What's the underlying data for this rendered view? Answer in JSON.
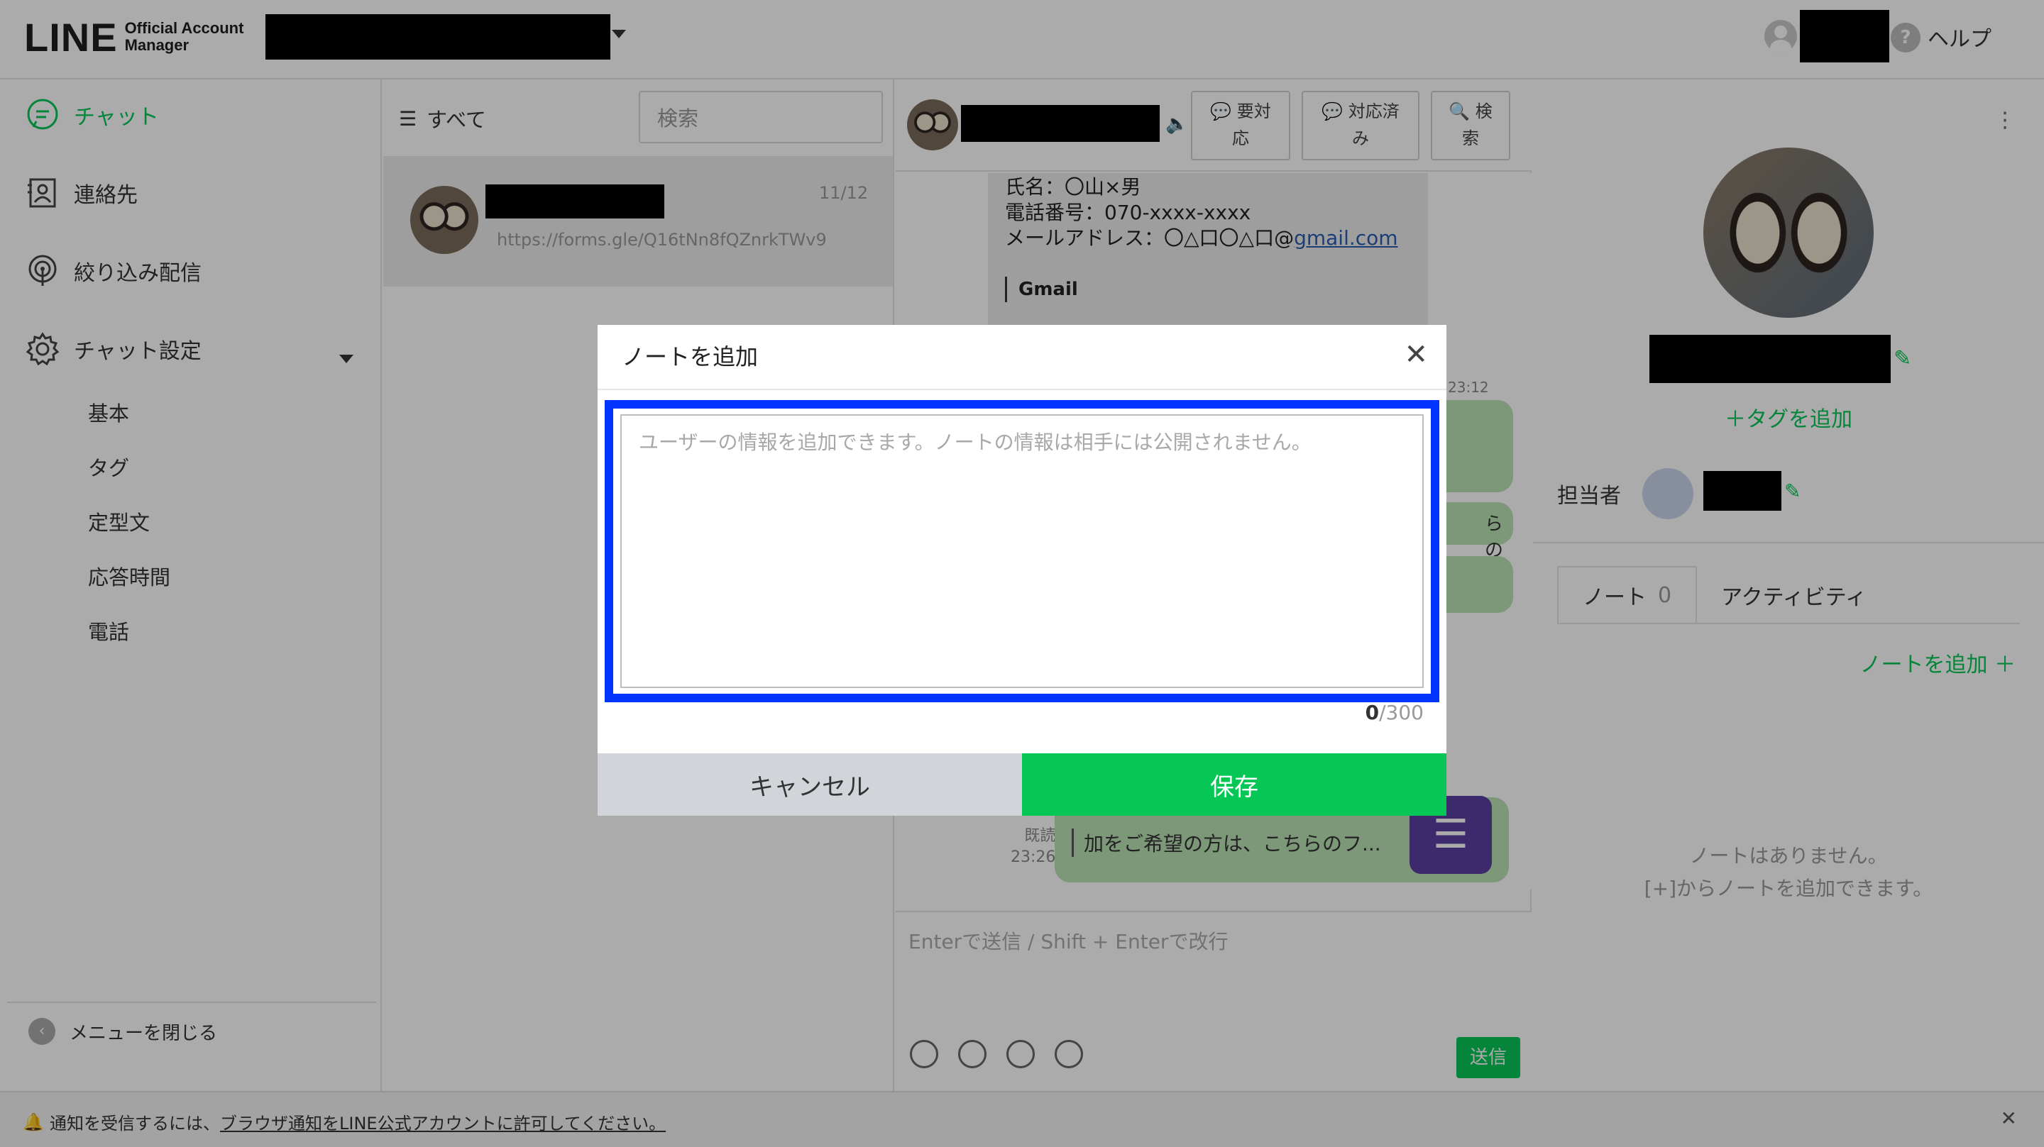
{
  "header": {
    "logo_main": "LINE",
    "logo_sub_1": "Official Account",
    "logo_sub_2": "Manager",
    "help_label": "ヘルプ",
    "help_glyph": "?"
  },
  "sidebar": {
    "items": [
      {
        "label": "チャット",
        "icon": "chat-bubble-icon"
      },
      {
        "label": "連絡先",
        "icon": "contact-card-icon"
      },
      {
        "label": "絞り込み配信",
        "icon": "broadcast-icon"
      },
      {
        "label": "チャット設定",
        "icon": "gear-icon"
      }
    ],
    "sub_items": [
      "基本",
      "タグ",
      "定型文",
      "応答時間",
      "電話"
    ],
    "close_menu_label": "メニューを閉じる",
    "close_menu_glyph": "‹"
  },
  "chatlist": {
    "filter_label": "すべて",
    "filter_glyph": "☰",
    "search_placeholder": "検索",
    "item": {
      "date": "11/12",
      "preview": "https://forms.gle/Q16tNn8fQZnrkTWv9"
    }
  },
  "chat": {
    "header_buttons": [
      {
        "label_1": "💬 要対",
        "label_2": "応"
      },
      {
        "label_1": "💬 対応済",
        "label_2": "み"
      },
      {
        "label_1": "🔍 検",
        "label_2": "索"
      }
    ],
    "mute_glyph": "🔈",
    "mail": {
      "line_1": "氏名：〇山×男",
      "line_2": "電話番号：070-xxxx-xxxx",
      "line_3_prefix": "メールアドレス：〇△口〇△口@",
      "line_3_link": "gmail.com",
      "gmail_label": "Gmail"
    },
    "time_a": "23:12",
    "partial_text": "らの",
    "read_label": "既読",
    "read_time": "23:26",
    "last_message": "加をご希望の方は、こちらのフ...",
    "menu_glyph": "☰",
    "composer_placeholder": "Enterで送信 / Shift + Enterで改行",
    "send_label": "送信"
  },
  "profile": {
    "kebab_glyph": "⋮",
    "edit_glyph": "✎",
    "add_tag_label": "＋タグを追加",
    "assignee_label": "担当者",
    "tabs": [
      {
        "label": "ノート",
        "count": "0"
      },
      {
        "label": "アクティビティ"
      }
    ],
    "add_note_label": "ノートを追加 ＋",
    "empty_line_1": "ノートはありません。",
    "empty_line_2": "[+]からノートを追加できます。"
  },
  "banner": {
    "bell_glyph": "🔔",
    "message_prefix": "通知を受信するには、",
    "message_link": "ブラウザ通知をLINE公式アカウントに許可してください。",
    "close_glyph": "✕"
  },
  "modal": {
    "title": "ノートを追加",
    "close_glyph": "✕",
    "textarea_placeholder": "ユーザーの情報を追加できます。ノートの情報は相手には公開されません。",
    "count_current": "0",
    "count_max": "/300",
    "cancel_label": "キャンセル",
    "save_label": "保存"
  }
}
